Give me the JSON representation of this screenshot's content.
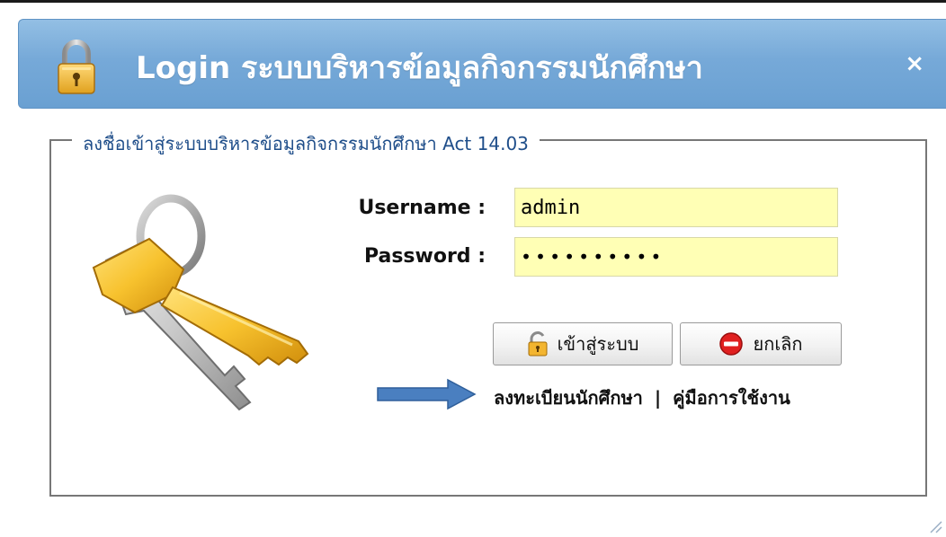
{
  "window": {
    "title": "Login ระบบบริหารข้อมูลกิจกรรมนักศึกษา",
    "close_symbol": "×"
  },
  "form": {
    "legend": "ลงชื่อเข้าสู่ระบบบริหารข้อมูลกิจกรรมนักศึกษา Act 14.03",
    "username_label": "Username :",
    "password_label": "Password :",
    "username_value": "admin",
    "password_value": "••••••••••"
  },
  "buttons": {
    "login_label": "เข้าสู่ระบบ",
    "cancel_label": "ยกเลิก"
  },
  "links": {
    "register": "ลงทะเบียนนักศึกษา",
    "separator": "|",
    "manual": "คู่มือการใช้งาน"
  },
  "icons": {
    "title": "padlock-icon",
    "keys": "keys-icon",
    "login": "unlocked-padlock-icon",
    "cancel": "no-entry-icon",
    "arrow": "arrow-right-icon",
    "resize": "resize-grip-icon"
  },
  "colors": {
    "titlebar": "#76a9d8",
    "legend_text": "#1f4e8a",
    "input_bg": "#ffffb5",
    "arrow": "#4a7fc0"
  }
}
